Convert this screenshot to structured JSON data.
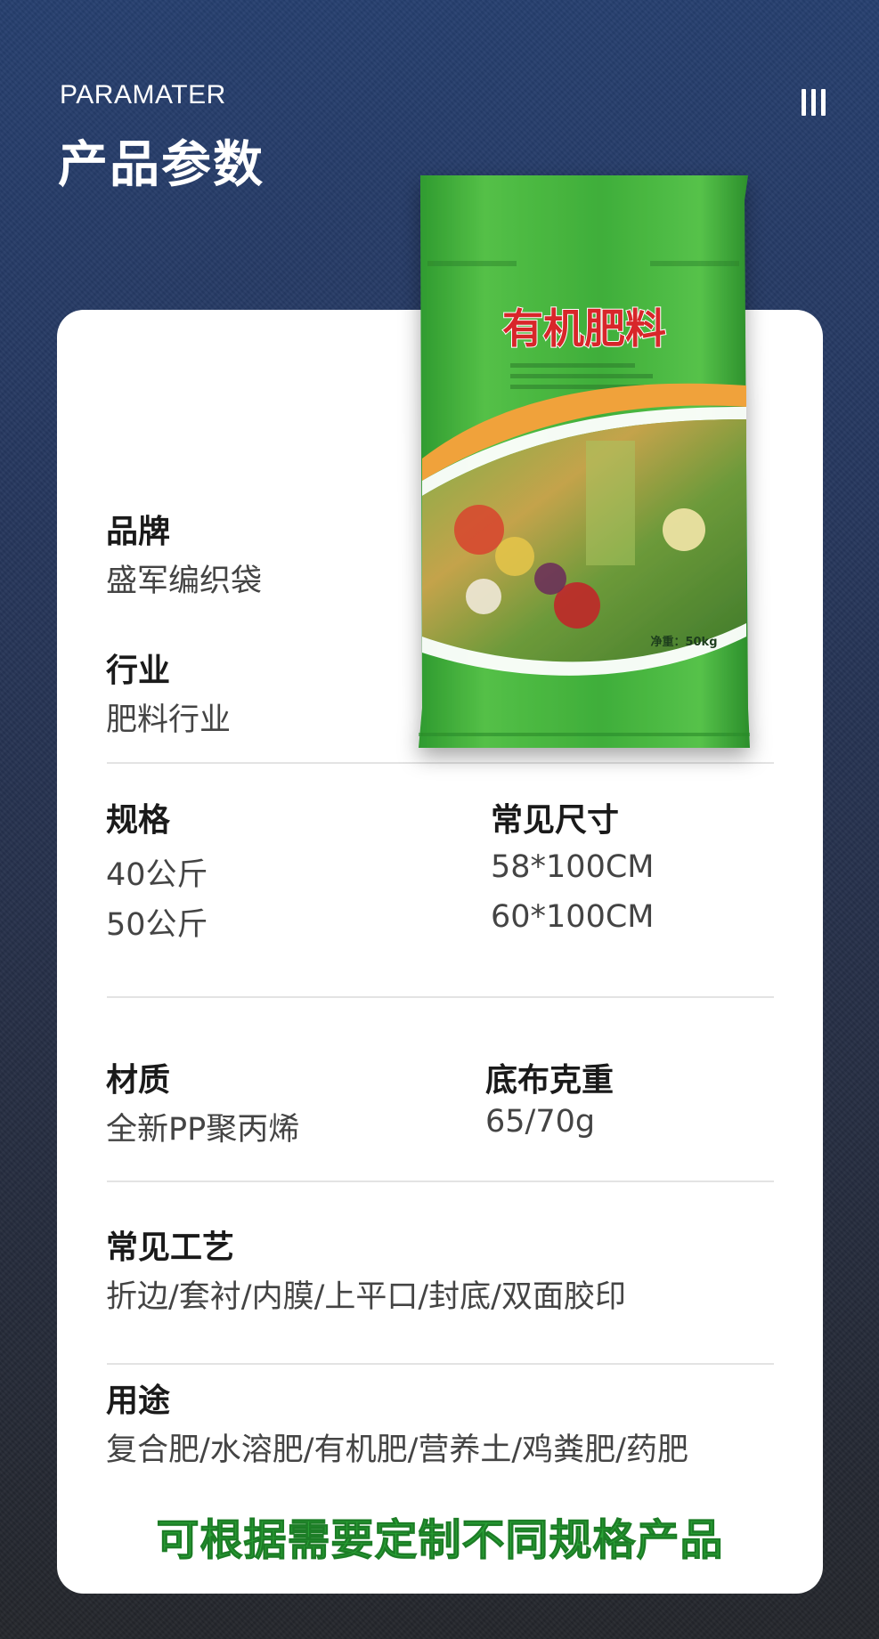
{
  "header": {
    "subtitle": "PARAMATER",
    "title": "产品参数"
  },
  "product_image": {
    "bag_title": "有机肥料",
    "net_weight": "净重：50kg",
    "bag_color": "#3fae3a"
  },
  "params": {
    "brand": {
      "label": "品牌",
      "value": "盛军编织袋"
    },
    "industry": {
      "label": "行业",
      "value": "肥料行业"
    },
    "spec": {
      "label": "规格",
      "values": [
        "40公斤",
        "50公斤"
      ]
    },
    "size": {
      "label": "常见尺寸",
      "values": [
        "58*100CM",
        "60*100CM"
      ]
    },
    "material": {
      "label": "材质",
      "value": "全新PP聚丙烯"
    },
    "weight": {
      "label": "底布克重",
      "value": "65/70g"
    },
    "craft": {
      "label": "常见工艺",
      "value": "折边/套衬/内膜/上平口/封底/双面胶印"
    },
    "usage": {
      "label": "用途",
      "value": "复合肥/水溶肥/有机肥/营养土/鸡粪肥/药肥"
    }
  },
  "slogan": "可根据需要定制不同规格产品",
  "colors": {
    "background": "#263f6f",
    "card": "#ffffff",
    "slogan": "#2aa336"
  }
}
